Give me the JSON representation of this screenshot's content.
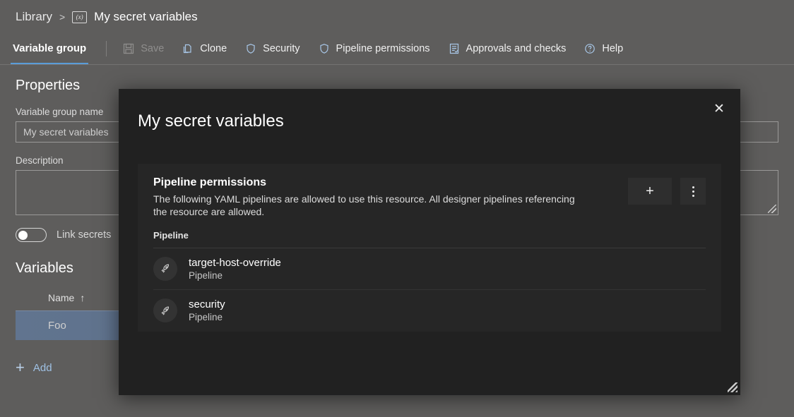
{
  "breadcrumb": {
    "root": "Library",
    "separator": ">",
    "icon_label": "(x)",
    "current": "My secret variables"
  },
  "command_bar": {
    "tab": "Variable group",
    "commands": [
      {
        "label": "Save",
        "icon": "save-icon",
        "disabled": true
      },
      {
        "label": "Clone",
        "icon": "clone-icon",
        "disabled": false
      },
      {
        "label": "Security",
        "icon": "shield-icon",
        "disabled": false
      },
      {
        "label": "Pipeline permissions",
        "icon": "shield-icon",
        "disabled": false
      },
      {
        "label": "Approvals and checks",
        "icon": "checklist-icon",
        "disabled": false
      },
      {
        "label": "Help",
        "icon": "help-circle-icon",
        "disabled": false
      }
    ]
  },
  "properties": {
    "heading": "Properties",
    "name_label": "Variable group name",
    "name_value": "My secret variables",
    "description_label": "Description",
    "description_value": "",
    "link_secrets_label": "Link secrets",
    "link_secrets_on": false
  },
  "variables": {
    "heading": "Variables",
    "column_name": "Name",
    "sort_indicator": "↑",
    "rows": [
      {
        "name": "Foo",
        "selected": true
      }
    ],
    "add_label": "Add"
  },
  "dialog": {
    "title": "My secret variables",
    "close_label": "✕",
    "panel": {
      "title": "Pipeline permissions",
      "description": "The following YAML pipelines are allowed to use this resource. All designer pipelines referencing the resource are allowed.",
      "add_button": "+",
      "more_button": "more-actions",
      "column_header": "Pipeline",
      "rows": [
        {
          "name": "target-host-override",
          "type": "Pipeline",
          "icon": "rocket-icon"
        },
        {
          "name": "security",
          "type": "Pipeline",
          "icon": "rocket-icon"
        }
      ]
    }
  },
  "colors": {
    "page_background": "#5e5d5c",
    "dialog_background": "#212121",
    "card_background": "#262626",
    "accent_blue": "#5a9cd8",
    "command_icon_blue": "#a8c7e8",
    "selected_row": "#61748f",
    "link_blue": "#9fc1e4"
  }
}
